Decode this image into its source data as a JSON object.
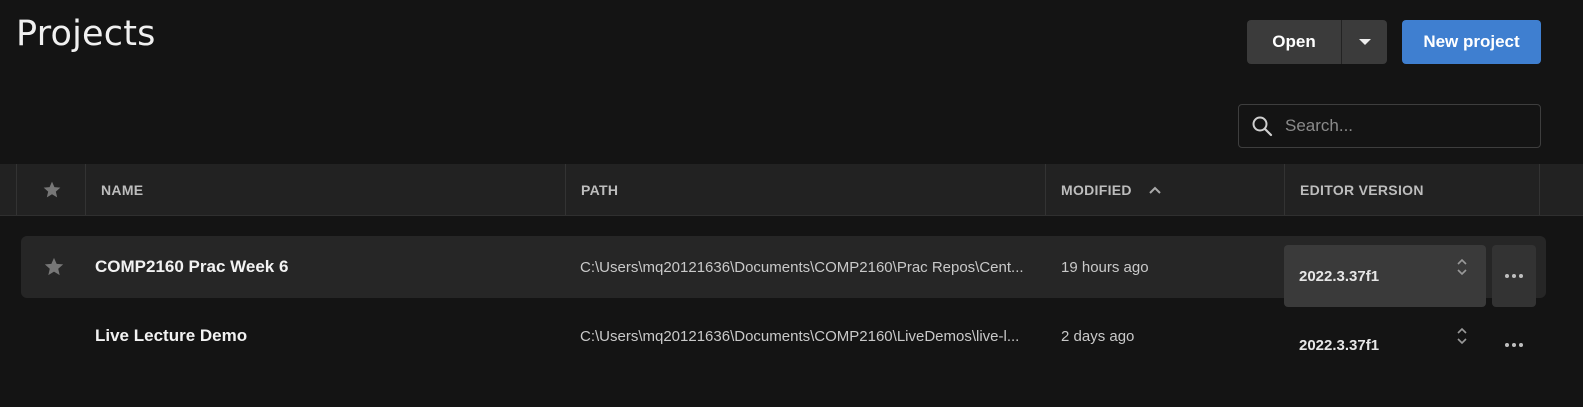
{
  "header": {
    "title": "Projects",
    "open_label": "Open",
    "new_project_label": "New project"
  },
  "search": {
    "placeholder": "Search...",
    "value": ""
  },
  "table": {
    "columns": {
      "name": "NAME",
      "path": "PATH",
      "modified": "MODIFIED",
      "editor_version": "EDITOR VERSION"
    },
    "sort": {
      "column": "modified",
      "direction": "ascending-icon"
    },
    "rows": [
      {
        "starred": false,
        "selected": true,
        "name": "COMP2160 Prac Week 6",
        "path": "C:\\Users\\mq20121636\\Documents\\COMP2160\\Prac Repos\\Cent...",
        "modified": "19 hours ago",
        "editor_version": "2022.3.37f1"
      },
      {
        "starred": false,
        "selected": false,
        "name": "Live Lecture Demo",
        "path": "C:\\Users\\mq20121636\\Documents\\COMP2160\\LiveDemos\\live-l...",
        "modified": "2 days ago",
        "editor_version": "2022.3.37f1"
      }
    ]
  },
  "colors": {
    "background": "#141414",
    "header_row": "#222222",
    "primary_button": "#3f7fd0",
    "secondary_button": "#3b3b3b"
  },
  "icons": [
    "star-icon",
    "search-icon",
    "chevron-down-icon",
    "sort-up-icon",
    "updown-chevron-icon",
    "more-icon"
  ]
}
